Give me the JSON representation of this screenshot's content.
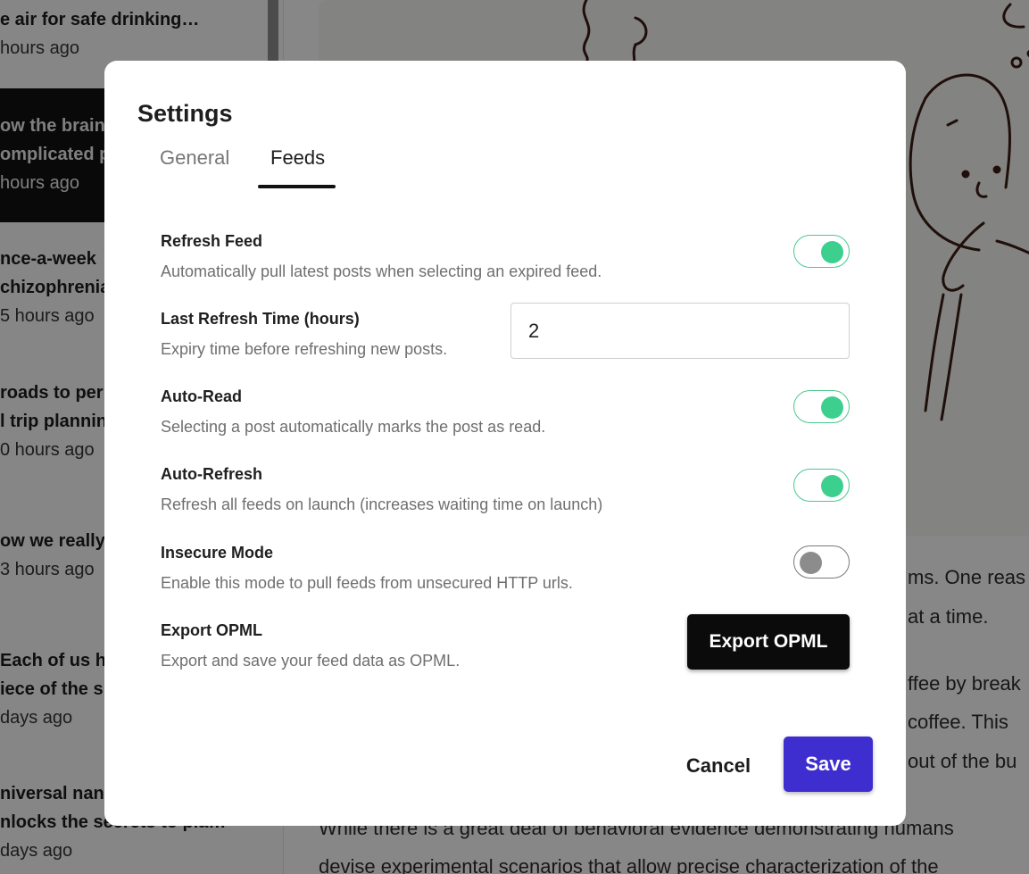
{
  "sidebar": {
    "posts": [
      {
        "title": "e air for safe drinking…",
        "time": "hours ago",
        "active": false
      },
      {
        "title": "ow the brain",
        "title2": "omplicated p",
        "time": "hours ago",
        "active": true
      },
      {
        "title": "nce-a-week",
        "title2": "chizophrenia",
        "time": "5 hours ago",
        "active": false
      },
      {
        "title": "roads to per",
        "title2": "l trip plannin",
        "time": "0 hours ago",
        "active": false
      },
      {
        "title": "ow we really",
        "time": "3 hours ago",
        "active": false
      },
      {
        "title": "Each of us ho",
        "title2": "iece of the s",
        "time": "days ago",
        "active": false
      },
      {
        "title": "niversal nan",
        "title2": "nlocks the secrets to pla…",
        "time": "days ago",
        "active": false
      }
    ]
  },
  "article": {
    "lines": [
      "ms. One reas",
      "at a time.",
      "ffee by break",
      "coffee. This",
      "out of the bu",
      "While there is a great deal of behavioral evidence demonstrating humans",
      "devise experimental scenarios that allow precise characterization of the"
    ]
  },
  "modal": {
    "title": "Settings",
    "tabs": [
      {
        "label": "General",
        "active": false
      },
      {
        "label": "Feeds",
        "active": true
      }
    ],
    "settings": {
      "refresh_feed": {
        "label": "Refresh Feed",
        "description": "Automatically pull latest posts when selecting an expired feed.",
        "enabled": true
      },
      "last_refresh_time": {
        "label": "Last Refresh Time (hours)",
        "description": "Expiry time before refreshing new posts.",
        "value": "2"
      },
      "auto_read": {
        "label": "Auto-Read",
        "description": "Selecting a post automatically marks the post as read.",
        "enabled": true
      },
      "auto_refresh": {
        "label": "Auto-Refresh",
        "description": "Refresh all feeds on launch (increases waiting time on launch)",
        "enabled": true
      },
      "insecure_mode": {
        "label": "Insecure Mode",
        "description": "Enable this mode to pull feeds from unsecured HTTP urls.",
        "enabled": false
      },
      "export_opml": {
        "label": "Export OPML",
        "description": "Export and save your feed data as OPML.",
        "button_label": "Export OPML"
      }
    },
    "cancel_label": "Cancel",
    "save_label": "Save"
  },
  "colors": {
    "toggle_on": "#3ccf8e",
    "toggle_off": "#8c8c8c",
    "save_button": "#3f2ecf",
    "export_button": "#0b0b0b"
  }
}
